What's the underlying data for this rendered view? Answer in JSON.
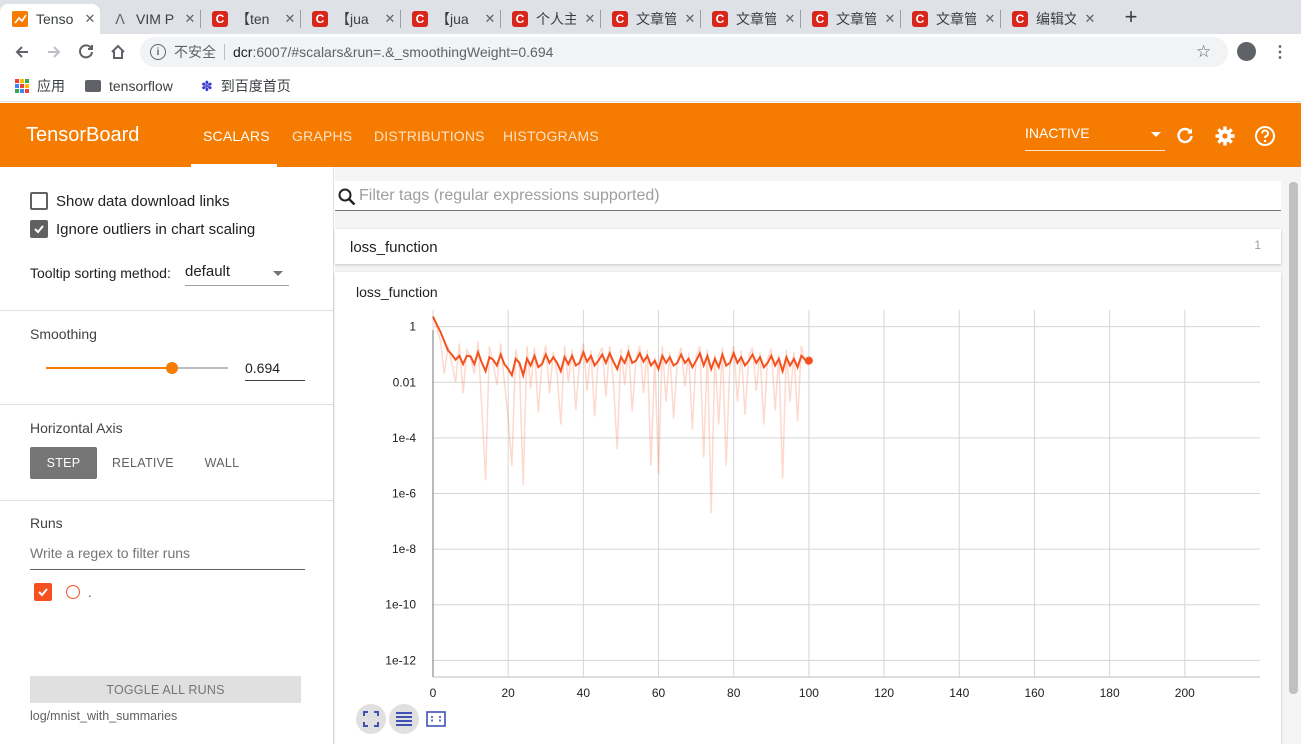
{
  "browser": {
    "tabs": [
      {
        "label": "Tenso",
        "icon": "tensorboard-icon",
        "active": true
      },
      {
        "label": "VIM P",
        "icon": "vim-icon"
      },
      {
        "label": "【ten",
        "icon": "csdn-icon"
      },
      {
        "label": "【jua",
        "icon": "csdn-icon"
      },
      {
        "label": "【jua",
        "icon": "csdn-icon"
      },
      {
        "label": "个人主",
        "icon": "csdn-icon"
      },
      {
        "label": "文章管",
        "icon": "csdn-icon"
      },
      {
        "label": "文章管",
        "icon": "csdn-icon"
      },
      {
        "label": "文章管",
        "icon": "csdn-icon"
      },
      {
        "label": "文章管",
        "icon": "csdn-icon"
      },
      {
        "label": "编辑文",
        "icon": "csdn-icon"
      }
    ],
    "new_tab": "+",
    "insecure_label": "不安全",
    "url_host": "dcr",
    "url_rest": ":6007/#scalars&run=.&_smoothingWeight=0.694",
    "bookmarks": [
      "应用",
      "tensorflow",
      "到百度首页"
    ]
  },
  "header": {
    "title": "TensorBoard",
    "tabs": [
      "SCALARS",
      "GRAPHS",
      "DISTRIBUTIONS",
      "HISTOGRAMS"
    ],
    "active_tab": "SCALARS",
    "status": "INACTIVE",
    "accent": "#f57c00"
  },
  "sidebar": {
    "show_download_links": "Show data download links",
    "ignore_outliers": "Ignore outliers in chart scaling",
    "tooltip_label": "Tooltip sorting method:",
    "tooltip_value": "default",
    "smoothing_title": "Smoothing",
    "smoothing_value": "0.694",
    "smoothing_fraction": 0.694,
    "horizontal_axis_title": "Horizontal Axis",
    "axis_options": [
      "STEP",
      "RELATIVE",
      "WALL"
    ],
    "axis_active": "STEP",
    "runs_title": "Runs",
    "runs_filter_placeholder": "Write a regex to filter runs",
    "run_name": ".",
    "toggle_all": "TOGGLE ALL RUNS",
    "logdir": "log/mnist_with_summaries"
  },
  "main": {
    "tag_filter_placeholder": "Filter tags (regular expressions supported)",
    "category_name": "loss_function",
    "category_count": "1",
    "chart_title": "loss_function"
  },
  "chart_data": {
    "type": "line",
    "title": "loss_function",
    "xlabel": "",
    "ylabel": "",
    "y_scale": "log",
    "xlim": [
      0,
      220
    ],
    "x_ticks": [
      "0",
      "20",
      "40",
      "60",
      "80",
      "100",
      "120",
      "140",
      "160",
      "180",
      "200"
    ],
    "y_ticks": [
      "1",
      "0.01",
      "1e-4",
      "1e-6",
      "1e-8",
      "1e-10",
      "1e-12"
    ],
    "grid": true,
    "smoothing": 0.694,
    "series": [
      {
        "name": ".",
        "color": "#f4511e",
        "x": [
          0,
          1,
          2,
          3,
          4,
          5,
          6,
          7,
          8,
          9,
          10,
          11,
          12,
          13,
          14,
          15,
          16,
          17,
          18,
          19,
          20,
          21,
          22,
          23,
          24,
          25,
          26,
          27,
          28,
          29,
          30,
          31,
          32,
          33,
          34,
          35,
          36,
          37,
          38,
          39,
          40,
          41,
          42,
          43,
          44,
          45,
          46,
          47,
          48,
          49,
          50,
          51,
          52,
          53,
          54,
          55,
          56,
          57,
          58,
          59,
          60,
          61,
          62,
          63,
          64,
          65,
          66,
          67,
          68,
          69,
          70,
          71,
          72,
          73,
          74,
          75,
          76,
          77,
          78,
          79,
          80,
          81,
          82,
          83,
          84,
          85,
          86,
          87,
          88,
          89,
          90,
          91,
          92,
          93,
          94,
          95,
          96,
          97,
          98,
          99,
          100
        ],
        "raw": [
          2.3,
          0.9,
          0.3,
          0.02,
          0.2,
          0.05,
          0.01,
          0.25,
          0.004,
          0.15,
          0.08,
          0.02,
          0.3,
          0.001,
          3e-06,
          0.2,
          0.05,
          0.008,
          0.25,
          0.01,
          0.0005,
          1e-05,
          0.15,
          0.03,
          2e-06,
          0.2,
          0.006,
          0.18,
          0.0008,
          0.05,
          0.22,
          0.004,
          0.12,
          0.02,
          0.0003,
          0.2,
          0.01,
          0.15,
          0.001,
          0.06,
          0.25,
          0.005,
          0.14,
          0.0006,
          0.09,
          0.18,
          0.003,
          0.2,
          0.01,
          4e-05,
          0.16,
          0.008,
          0.22,
          0.0009,
          0.07,
          0.2,
          0.004,
          0.15,
          1e-05,
          0.08,
          5e-06,
          0.2,
          0.002,
          0.12,
          0.0005,
          0.06,
          0.18,
          0.007,
          0.11,
          0.0002,
          0.09,
          0.2,
          2e-05,
          0.15,
          2e-07,
          0.1,
          0.0003,
          0.18,
          1e-05,
          0.06,
          0.2,
          0.002,
          0.14,
          0.0007,
          0.09,
          0.18,
          0.005,
          0.12,
          0.0003,
          0.07,
          0.16,
          0.001,
          0.1,
          3.5e-06,
          0.15,
          0.002,
          0.12,
          0.0004,
          0.2,
          0.05,
          0.04
        ],
        "smoothed": [
          2.3,
          1.2,
          0.65,
          0.3,
          0.14,
          0.1,
          0.065,
          0.09,
          0.045,
          0.09,
          0.085,
          0.045,
          0.12,
          0.05,
          0.025,
          0.08,
          0.065,
          0.04,
          0.1,
          0.045,
          0.03,
          0.018,
          0.07,
          0.05,
          0.018,
          0.07,
          0.04,
          0.09,
          0.035,
          0.045,
          0.1,
          0.05,
          0.08,
          0.05,
          0.025,
          0.08,
          0.045,
          0.09,
          0.04,
          0.05,
          0.12,
          0.055,
          0.09,
          0.04,
          0.06,
          0.1,
          0.05,
          0.11,
          0.055,
          0.03,
          0.08,
          0.05,
          0.12,
          0.05,
          0.06,
          0.11,
          0.055,
          0.09,
          0.04,
          0.06,
          0.03,
          0.09,
          0.05,
          0.08,
          0.04,
          0.05,
          0.1,
          0.05,
          0.07,
          0.035,
          0.06,
          0.11,
          0.04,
          0.09,
          0.03,
          0.07,
          0.035,
          0.1,
          0.04,
          0.05,
          0.11,
          0.05,
          0.08,
          0.04,
          0.06,
          0.1,
          0.05,
          0.08,
          0.035,
          0.05,
          0.09,
          0.04,
          0.07,
          0.025,
          0.08,
          0.04,
          0.07,
          0.035,
          0.09,
          0.065,
          0.06
        ]
      }
    ]
  }
}
